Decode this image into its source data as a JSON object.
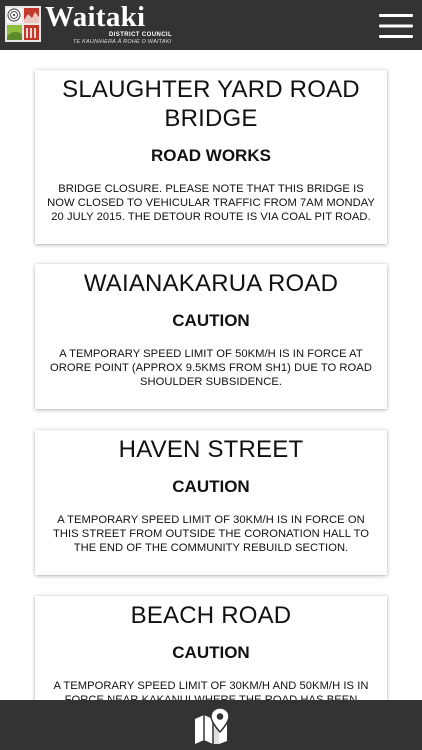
{
  "header": {
    "logo_name": "Waitaki",
    "logo_council": "DISTRICT COUNCIL",
    "logo_tagline": "TE KAUNIHERA Ā ROHE O WAITAKI"
  },
  "notices": [
    {
      "title": "SLAUGHTER YARD ROAD BRIDGE",
      "type": "ROAD WORKS",
      "description": "BRIDGE CLOSURE. PLEASE NOTE THAT THIS BRIDGE IS NOW CLOSED TO VEHICULAR TRAFFIC FROM 7AM MONDAY 20 JULY 2015. THE DETOUR ROUTE IS VIA COAL PIT ROAD."
    },
    {
      "title": "WAIANAKARUA ROAD",
      "type": "CAUTION",
      "description": "A TEMPORARY SPEED LIMIT OF 50KM/H IS IN FORCE AT ORORE POINT (APPROX 9.5KMS FROM SH1) DUE TO ROAD SHOULDER SUBSIDENCE."
    },
    {
      "title": "HAVEN STREET",
      "type": "CAUTION",
      "description": "A TEMPORARY SPEED LIMIT OF 30KM/H IS IN FORCE ON THIS STREET FROM OUTSIDE THE CORONATION HALL TO THE END OF THE COMMUNITY REBUILD SECTION."
    },
    {
      "title": "BEACH ROAD",
      "type": "CAUTION",
      "description": "A TEMPORARY SPEED LIMIT OF 30KM/H AND 50KM/H IS IN FORCE NEAR KAKANUI WHERE THE ROAD HAS BEEN"
    }
  ],
  "icons": {
    "menu": "hamburger-menu-icon",
    "map": "map-pin-icon",
    "logo": "council-logo-icon"
  },
  "colors": {
    "bar_background": "#333333",
    "card_background": "#ffffff",
    "text": "#111111"
  }
}
